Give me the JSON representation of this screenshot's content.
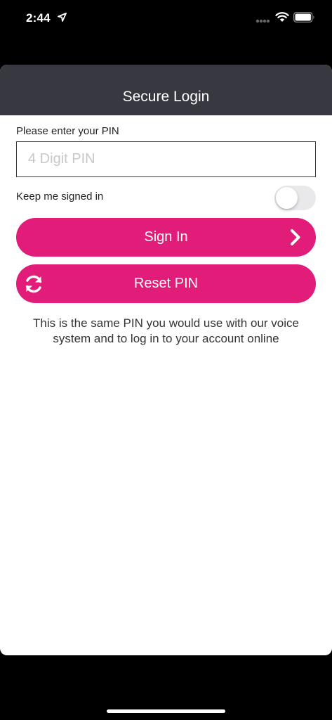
{
  "status_bar": {
    "time": "2:44"
  },
  "nav": {
    "title": "Secure Login"
  },
  "pin": {
    "label": "Please enter your PIN",
    "placeholder": "4 Digit PIN",
    "value": ""
  },
  "keep_signed_in": {
    "label": "Keep me signed in",
    "enabled": false
  },
  "buttons": {
    "sign_in": "Sign In",
    "reset_pin": "Reset PIN"
  },
  "help_text": "This is the same PIN you would use with our voice system and to log in to your account online",
  "colors": {
    "accent": "#e21c79",
    "nav_bar": "#383840",
    "toggle_off": "#e9e9eb"
  }
}
